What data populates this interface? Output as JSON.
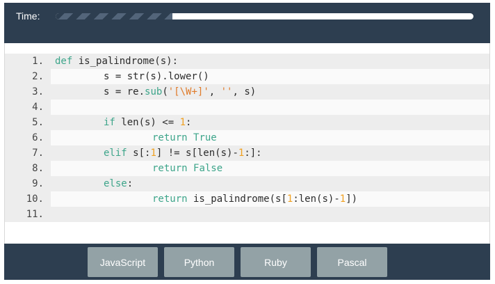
{
  "timer": {
    "label": "Time:",
    "elapsed_fraction": 0.28
  },
  "code": {
    "lines": [
      {
        "num": "1.",
        "indent": 0,
        "tokens": [
          {
            "t": "def",
            "c": "kw"
          },
          {
            "t": " is_palindrome(s):",
            "c": ""
          }
        ]
      },
      {
        "num": "2.",
        "indent": 1,
        "tokens": [
          {
            "t": "s = str(s).lower()",
            "c": ""
          }
        ]
      },
      {
        "num": "3.",
        "indent": 1,
        "tokens": [
          {
            "t": "s = re.",
            "c": ""
          },
          {
            "t": "sub",
            "c": "kw"
          },
          {
            "t": "(",
            "c": ""
          },
          {
            "t": "'[\\W+]'",
            "c": "str"
          },
          {
            "t": ", ",
            "c": ""
          },
          {
            "t": "''",
            "c": "str"
          },
          {
            "t": ", s)",
            "c": ""
          }
        ]
      },
      {
        "num": "4.",
        "indent": 0,
        "tokens": []
      },
      {
        "num": "5.",
        "indent": 1,
        "tokens": [
          {
            "t": "if",
            "c": "kw"
          },
          {
            "t": " len(s) <= ",
            "c": ""
          },
          {
            "t": "1",
            "c": "num"
          },
          {
            "t": ":",
            "c": ""
          }
        ]
      },
      {
        "num": "6.",
        "indent": 2,
        "tokens": [
          {
            "t": "return",
            "c": "kw"
          },
          {
            "t": " ",
            "c": ""
          },
          {
            "t": "True",
            "c": "kw"
          }
        ]
      },
      {
        "num": "7.",
        "indent": 1,
        "tokens": [
          {
            "t": "elif",
            "c": "kw"
          },
          {
            "t": " s[:",
            "c": ""
          },
          {
            "t": "1",
            "c": "num"
          },
          {
            "t": "] != s[len(s)-",
            "c": ""
          },
          {
            "t": "1",
            "c": "num"
          },
          {
            "t": ":]:",
            "c": ""
          }
        ]
      },
      {
        "num": "8.",
        "indent": 2,
        "tokens": [
          {
            "t": "return",
            "c": "kw"
          },
          {
            "t": " ",
            "c": ""
          },
          {
            "t": "False",
            "c": "kw"
          }
        ]
      },
      {
        "num": "9.",
        "indent": 1,
        "tokens": [
          {
            "t": "else",
            "c": "kw"
          },
          {
            "t": ":",
            "c": ""
          }
        ]
      },
      {
        "num": "10.",
        "indent": 2,
        "tokens": [
          {
            "t": "return",
            "c": "kw"
          },
          {
            "t": " is_palindrome(s[",
            "c": ""
          },
          {
            "t": "1",
            "c": "num"
          },
          {
            "t": ":len(s)-",
            "c": ""
          },
          {
            "t": "1",
            "c": "num"
          },
          {
            "t": "])",
            "c": ""
          }
        ]
      },
      {
        "num": "11.",
        "indent": 0,
        "tokens": []
      }
    ]
  },
  "languages": {
    "javascript": "JavaScript",
    "python": "Python",
    "ruby": "Ruby",
    "pascal": "Pascal"
  },
  "colors": {
    "panel_dark": "#2d3e50",
    "button": "#93a2a6",
    "keyword": "#3da58a",
    "string": "#e07b2a",
    "number": "#f0a020"
  }
}
